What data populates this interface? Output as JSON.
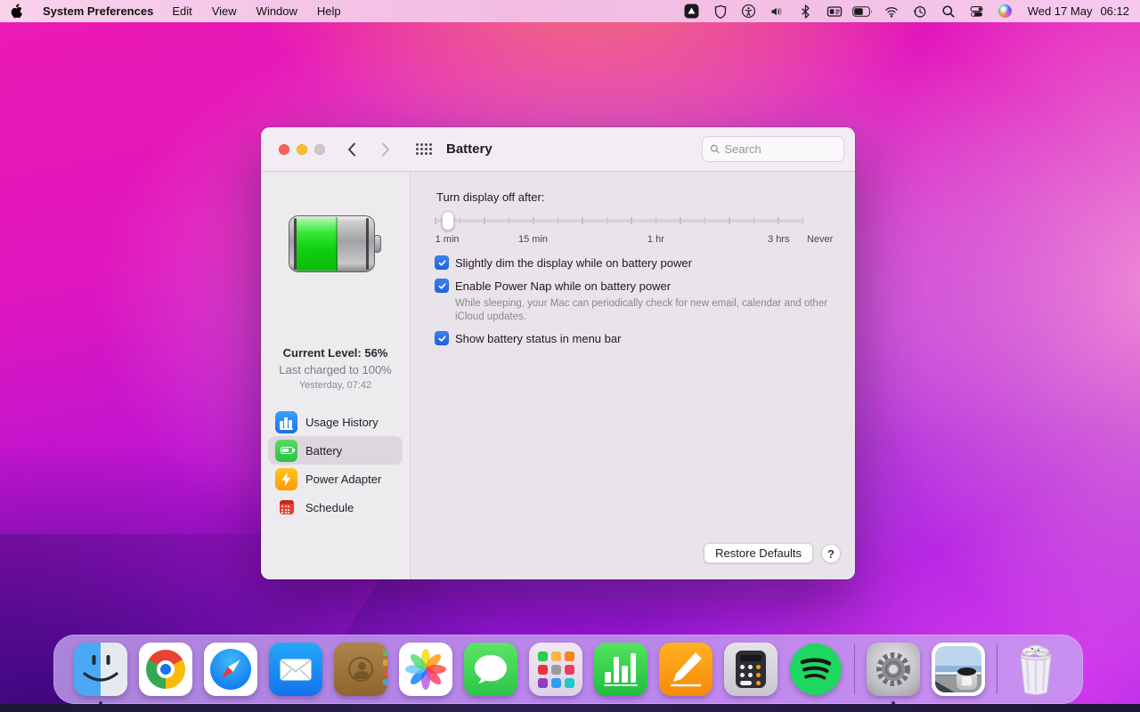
{
  "menu_bar": {
    "app_name": "System Preferences",
    "menus": [
      "Edit",
      "View",
      "Window",
      "Help"
    ],
    "status_icons": [
      "triangle-app-icon",
      "location-shield-icon",
      "accessibility-icon",
      "volume-icon",
      "bluetooth-icon",
      "input-source-icon",
      "battery-status-icon",
      "wifi-icon",
      "time-machine-icon",
      "spotlight-icon",
      "control-center-icon",
      "siri-icon"
    ],
    "clock": {
      "date": "Wed 17 May",
      "time": "06:12"
    }
  },
  "window": {
    "title": "Battery",
    "search": {
      "placeholder": "Search"
    },
    "sidebar": {
      "battery_level_percent": 56,
      "current_level": "Current Level: 56%",
      "last_charged": "Last charged to 100%",
      "last_charged_time": "Yesterday, 07:42",
      "items": [
        {
          "label": "Usage History",
          "icon": "usage-history-icon",
          "selected": false
        },
        {
          "label": "Battery",
          "icon": "battery-icon",
          "selected": true
        },
        {
          "label": "Power Adapter",
          "icon": "power-adapter-icon",
          "selected": false
        },
        {
          "label": "Schedule",
          "icon": "schedule-icon",
          "selected": false
        }
      ]
    },
    "content": {
      "display_off_label": "Turn display off after:",
      "slider": {
        "tick_count": 16,
        "labels": [
          "1 min",
          "15 min",
          "1 hr",
          "3 hrs",
          "Never"
        ]
      },
      "checkboxes": [
        {
          "label": "Slightly dim the display while on battery power",
          "checked": true
        },
        {
          "label": "Enable Power Nap while on battery power",
          "checked": true,
          "description": "While sleeping, your Mac can periodically check for new email, calendar and other iCloud updates."
        },
        {
          "label": "Show battery status in menu bar",
          "checked": true
        }
      ],
      "restore_defaults": "Restore Defaults",
      "help": "?"
    }
  },
  "dock": {
    "items": [
      "finder",
      "chrome",
      "safari",
      "mail",
      "contacts",
      "photos",
      "messages",
      "launchpad",
      "numbers",
      "pages",
      "calculator",
      "spotify",
      "system-preferences",
      "pictures",
      "trash"
    ],
    "running": [
      "finder",
      "system-preferences"
    ]
  },
  "colors": {
    "accent_blue": "#2169e6",
    "battery_green": "#12d412",
    "selected_row": "#dcd7dd",
    "menu_bar_pink": "#f3c0e5",
    "dock_background": "rgba(197,166,241,0.78)",
    "wallpaper_top": "#ec1ab2",
    "wallpaper_bottom": "#9114de"
  }
}
